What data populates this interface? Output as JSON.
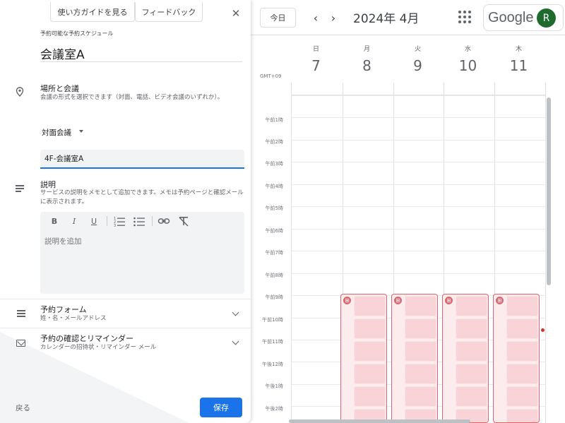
{
  "calendar": {
    "today_label": "今日",
    "prev_icon": "chevron-left-icon",
    "next_icon": "chevron-right-icon",
    "month_title": "2024年 4月",
    "apps_icon": "apps-grid-icon",
    "brand": "Google",
    "avatar_initial": "R",
    "timezone": "GMT+09",
    "days": [
      {
        "dow": "日",
        "num": "7"
      },
      {
        "dow": "月",
        "num": "8"
      },
      {
        "dow": "火",
        "num": "9"
      },
      {
        "dow": "水",
        "num": "10"
      },
      {
        "dow": "木",
        "num": "11"
      }
    ],
    "hours": [
      "午前1時",
      "午前2時",
      "午前3時",
      "午前4時",
      "午前5時",
      "午前6時",
      "午前7時",
      "午前8時",
      "午前9時",
      "午前10時",
      "午前11時",
      "午後12時",
      "午後1時",
      "午後2時"
    ],
    "availability_icon": "calendar-grid-icon",
    "colors": {
      "block_border": "#d9666f",
      "block_fill": "#fdecee",
      "slot_fill": "#f8d3d7",
      "accent": "#1a73e8"
    }
  },
  "panel": {
    "guide_button": "使い方ガイドを見る",
    "feedback_button": "フィードバック",
    "close_icon": "close-icon",
    "schedule_caption": "予約可能な予約スケジュール",
    "schedule_title": "会議室A",
    "location": {
      "icon": "location-pin-icon",
      "title": "場所と会議",
      "description": "会議の形式を選択できます（対面、電話、ビデオ会議のいずれか）。",
      "mode": "対面会議",
      "room_value": "4F-会議室A"
    },
    "description": {
      "icon": "notes-icon",
      "title": "説明",
      "help": "サービスの説明をメモとして追加できます。メモは予約ページと確認メールに表示されます。",
      "placeholder": "説明を追加",
      "toolbar": {
        "bold": "B",
        "italic": "I",
        "underline": "U"
      }
    },
    "booking_form": {
      "icon": "list-icon",
      "title": "予約フォーム",
      "subtitle": "姓・名・メールアドレス"
    },
    "confirmation": {
      "icon": "mail-icon",
      "title": "予約の確認とリマインダー",
      "subtitle": "カレンダーの招待状・リマインダー メール"
    },
    "back_button": "戻る",
    "save_button": "保存"
  }
}
